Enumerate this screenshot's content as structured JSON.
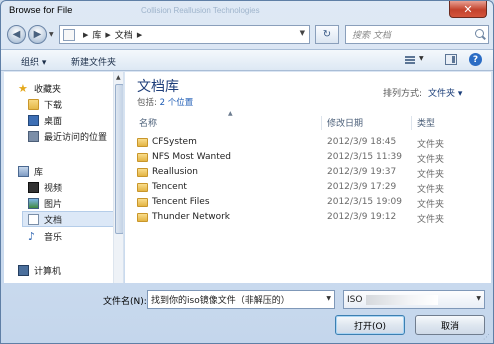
{
  "window": {
    "title": "Browse for File",
    "background_title": "Collision   Reallusion Technologies"
  },
  "address": {
    "crumbs": [
      "库",
      "文档"
    ],
    "search_placeholder": "搜索 文档"
  },
  "toolbar": {
    "organize": "组织 ▾",
    "new_folder": "新建文件夹"
  },
  "nav": {
    "favorites_label": "收藏夹",
    "favorites": [
      "下载",
      "桌面",
      "最近访问的位置"
    ],
    "libraries_label": "库",
    "libraries": [
      "视频",
      "图片",
      "文档",
      "音乐"
    ],
    "computer_label": "计算机"
  },
  "library": {
    "title": "文档库",
    "includes_label": "包括:",
    "locations": "2 个位置",
    "arrange_label": "排列方式:",
    "arrange_value": "文件夹 ▾"
  },
  "columns": {
    "name": "名称",
    "modified": "修改日期",
    "type": "类型"
  },
  "files": [
    {
      "name": "CFSystem",
      "date": "2012/3/9 18:45",
      "type": "文件夹"
    },
    {
      "name": "NFS Most Wanted",
      "date": "2012/3/15 11:39",
      "type": "文件夹"
    },
    {
      "name": "Reallusion",
      "date": "2012/3/9 19:37",
      "type": "文件夹"
    },
    {
      "name": "Tencent",
      "date": "2012/3/9 17:29",
      "type": "文件夹"
    },
    {
      "name": "Tencent Files",
      "date": "2012/3/15 19:09",
      "type": "文件夹"
    },
    {
      "name": "Thunder Network",
      "date": "2012/3/9 19:12",
      "type": "文件夹"
    }
  ],
  "bottom": {
    "filename_label": "文件名(N):",
    "filename_value": "找到你的iso镜像文件（非解压的）",
    "filter_value": "ISO",
    "open_label": "打开(O)",
    "cancel_label": "取消"
  }
}
